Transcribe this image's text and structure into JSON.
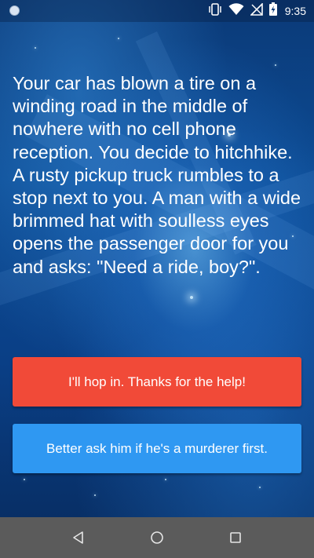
{
  "status_bar": {
    "time": "9:35",
    "icons": [
      "notification-dot-icon",
      "vibrate-icon",
      "wifi-icon",
      "no-signal-icon",
      "battery-charging-icon"
    ]
  },
  "story": {
    "text": "Your car has blown a tire on a winding road in the middle of nowhere with no cell phone reception. You decide to hitchhike. A rusty pickup truck rumbles to a stop next to you. A man with a wide brimmed hat with soulless eyes opens the passenger door for you and asks: \"Need a ride, boy?\"."
  },
  "choices": [
    {
      "label": "I'll hop in. Thanks for the help!",
      "color": "#f14a38"
    },
    {
      "label": "Better ask him if he's a murderer first.",
      "color": "#2f98f2"
    }
  ],
  "nav_bar": {
    "buttons": [
      "back-icon",
      "home-icon",
      "recents-icon"
    ]
  },
  "colors": {
    "background": "#0c4b93",
    "nav_bar": "#5b5b5b",
    "text": "#ffffff"
  }
}
